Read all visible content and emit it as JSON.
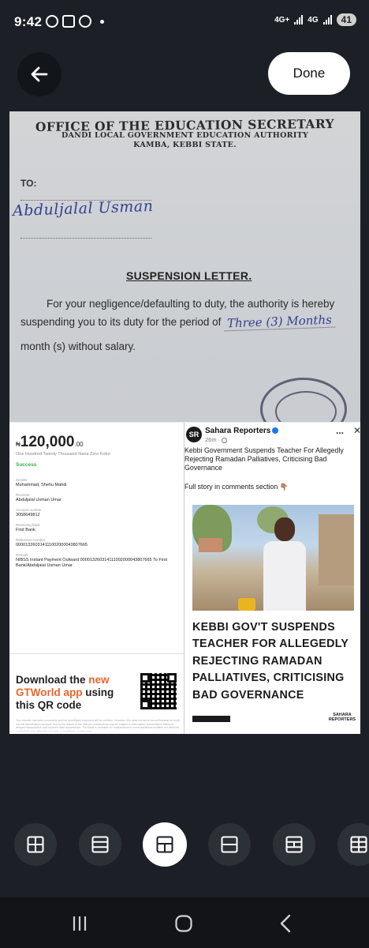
{
  "status_bar": {
    "time": "9:42",
    "network_1": "4G+",
    "network_2": "4G",
    "battery": "41",
    "notification_icons": [
      "whatsapp-icon",
      "tiktok-icon",
      "messenger-icon"
    ]
  },
  "toolbar": {
    "done_label": "Done"
  },
  "letter": {
    "office_title": "OFFICE OF THE EDUCATION SECRETARY",
    "authority": "DANDI LOCAL GOVERNMENT EDUCATION AUTHORITY",
    "location": "KAMBA, KEBBI STATE.",
    "to_label": "TO:",
    "recipient_handwritten": "Abduljalal Usman",
    "title": "SUSPENSION LETTER.",
    "body_line_1": "For your negligence/defaulting to duty, the authority is hereby",
    "body_line_2_prefix": "suspending you to its duty for the period of",
    "body_line_2_handwritten": "Three (3) Months",
    "body_line_3": "month (s) without salary."
  },
  "receipt": {
    "currency_symbol": "₦",
    "amount": "120,000",
    "amount_decimal": ".00",
    "amount_words": "One Hundred Twenty Thousand  Naira Zero Kobo",
    "status": "Success",
    "fields": [
      {
        "label": "Sender",
        "value": "Muhammad, Shehu Mahdi"
      },
      {
        "label": "Receiver",
        "value": "Abduljalal Usman Umar"
      },
      {
        "label": "Account number",
        "value": "3058649812"
      },
      {
        "label": "Receiving bank",
        "value": "First Bank"
      },
      {
        "label": "Reference number",
        "value": "000013260314111002000043807665"
      },
      {
        "label": "Remark",
        "value": "NIBSS Instant Payment Outward 000013260314111002000043807665  To First Bank/Abduljalal Usman Umar"
      }
    ],
    "download_prefix": "Download the",
    "download_new": "new",
    "download_app": "GTWorld app",
    "download_suffix_1": "using",
    "download_suffix_2": "this QR code",
    "fine_print": "Your transfer has been successful and the beneficiary's account will be credited. However, this does not serve as confirmation of credit into the beneficiary's account. Due to the nature of the Internet, transactions may be subject to interruption, transmission blackout, delayed transmission and incorrect data transmission. The Bank is not liable for malfunctions in communications facilities not within its control that may affect the accuracy or timeliness of messages"
  },
  "news_post": {
    "page_name": "Sahara Reporters",
    "logo_text": "SR",
    "time": "26m · ",
    "more": "...",
    "close": "✕",
    "text": "Kebbi Government Suspends Teacher For Allegedly Rejecting Ramadan Palliatives, Criticising Bad Governance",
    "cta": "Full story in comments section 👇🏽",
    "headline": "KEBBI GOV'T SUSPENDS TEACHER FOR ALLEGEDLY REJECTING RAMADAN PALLIATIVES, CRITICISING BAD GOVERNANCE",
    "brand": "SAHARA REPORTERS"
  },
  "layout_options": [
    {
      "name": "layout-grid-4",
      "selected": false
    },
    {
      "name": "layout-rows-3",
      "selected": false
    },
    {
      "name": "layout-top-split-bottom",
      "selected": true
    },
    {
      "name": "layout-rows-2",
      "selected": false
    },
    {
      "name": "layout-mixed",
      "selected": false
    },
    {
      "name": "layout-grid-6",
      "selected": false
    }
  ],
  "colors": {
    "background": "#1c2026",
    "accent_orange": "#e8672a",
    "success_green": "#2eb34a",
    "handwriting_blue": "#33418d"
  }
}
